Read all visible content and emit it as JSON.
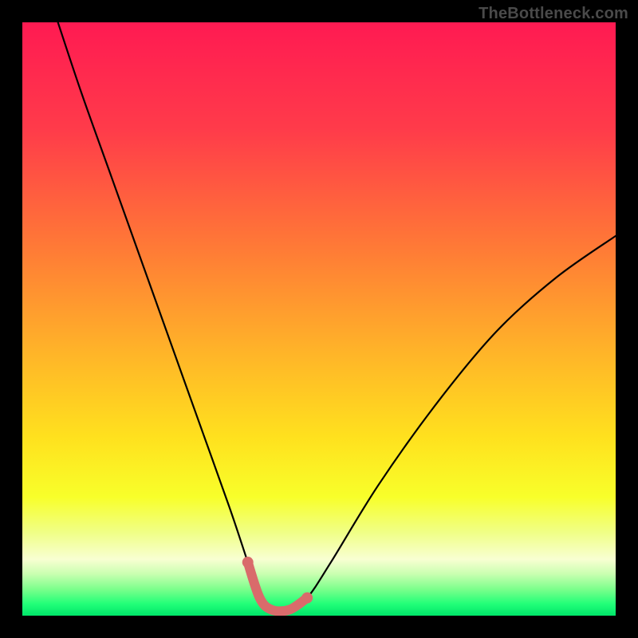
{
  "watermark": "TheBottleneck.com",
  "colors": {
    "frame": "#000000",
    "curve": "#000000",
    "highlight": "#d96b6b",
    "gradient_stops": [
      {
        "offset": 0.0,
        "color": "#ff1a52"
      },
      {
        "offset": 0.18,
        "color": "#ff3b4a"
      },
      {
        "offset": 0.38,
        "color": "#ff7a36"
      },
      {
        "offset": 0.55,
        "color": "#ffb229"
      },
      {
        "offset": 0.7,
        "color": "#ffe11e"
      },
      {
        "offset": 0.8,
        "color": "#f8ff2a"
      },
      {
        "offset": 0.86,
        "color": "#f0ff87"
      },
      {
        "offset": 0.905,
        "color": "#f8ffd2"
      },
      {
        "offset": 0.93,
        "color": "#c9ffb0"
      },
      {
        "offset": 0.955,
        "color": "#7dff8c"
      },
      {
        "offset": 0.98,
        "color": "#22ff78"
      },
      {
        "offset": 1.0,
        "color": "#00e56a"
      }
    ]
  },
  "chart_data": {
    "type": "line",
    "title": "",
    "xlabel": "",
    "ylabel": "",
    "xlim": [
      0,
      100
    ],
    "ylim": [
      0,
      100
    ],
    "series": [
      {
        "name": "bottleneck-curve",
        "x": [
          6,
          10,
          15,
          20,
          25,
          30,
          35,
          38,
          40,
          42,
          45,
          48,
          52,
          60,
          70,
          80,
          90,
          100
        ],
        "y": [
          100,
          88,
          74,
          60,
          46,
          32,
          18,
          9,
          3,
          1,
          1,
          3,
          9,
          22,
          36,
          48,
          57,
          64
        ]
      }
    ],
    "highlight_range": {
      "x_start": 38,
      "x_end": 48,
      "stroke_width": 12
    }
  }
}
